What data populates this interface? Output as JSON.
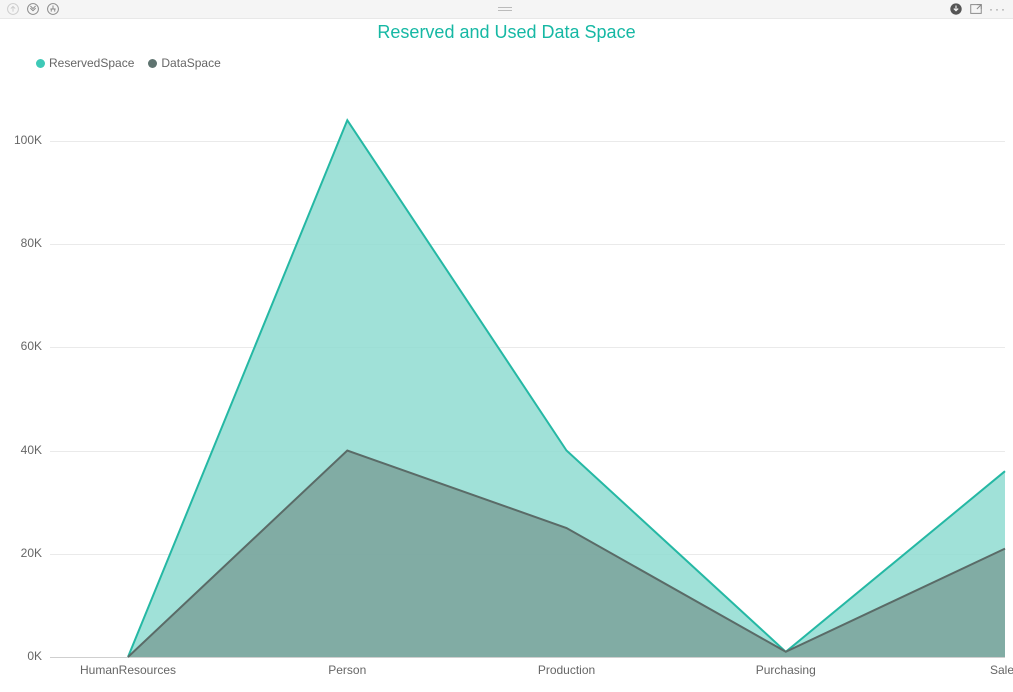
{
  "title": "Reserved and Used Data Space",
  "legend": {
    "items": [
      {
        "label": "ReservedSpace",
        "color": "#3ec9b7"
      },
      {
        "label": "DataSpace",
        "color": "#5f7470"
      }
    ]
  },
  "y_ticks": [
    "0K",
    "20K",
    "40K",
    "60K",
    "80K",
    "100K"
  ],
  "x_ticks": [
    "HumanResources",
    "Person",
    "Production",
    "Purchasing",
    "Sales"
  ],
  "colors": {
    "reserved_fill": "#8fdcd1",
    "reserved_stroke": "#25b8a4",
    "data_fill": "#7ba29b",
    "data_stroke": "#5a6b67"
  },
  "chart_data": {
    "type": "area",
    "title": "Reserved and Used Data Space",
    "xlabel": "",
    "ylabel": "",
    "ylim": [
      0,
      105000
    ],
    "categories": [
      "HumanResources",
      "Person",
      "Production",
      "Purchasing",
      "Sales"
    ],
    "series": [
      {
        "name": "ReservedSpace",
        "values": [
          0,
          104000,
          40000,
          1000,
          36000
        ]
      },
      {
        "name": "DataSpace",
        "values": [
          0,
          40000,
          25000,
          1000,
          21000
        ]
      }
    ]
  }
}
